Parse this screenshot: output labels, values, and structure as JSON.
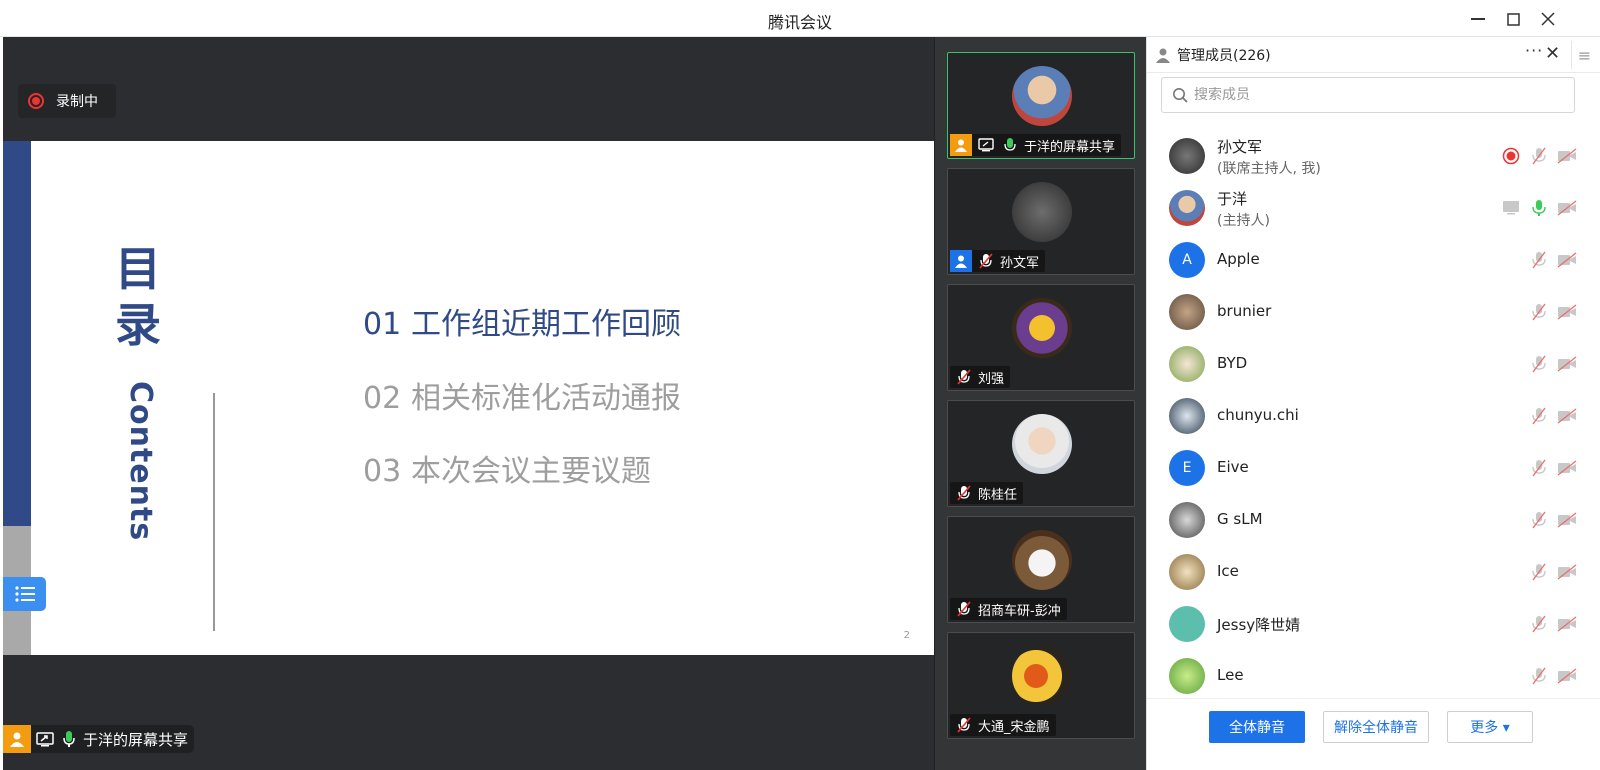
{
  "window": {
    "title": "腾讯会议",
    "minimize_icon": "minimize-icon",
    "maximize_icon": "maximize-icon",
    "close_icon": "close-icon"
  },
  "recording": {
    "label": "录制中",
    "color": "#e33333"
  },
  "slide": {
    "heading": "目录",
    "heading_en": "Contents",
    "items": [
      {
        "num": "01",
        "text": "工作组近期工作回顾"
      },
      {
        "num": "02",
        "text": "相关标准化活动通报"
      },
      {
        "num": "03",
        "text": "本次会议主要议题"
      }
    ],
    "page_number": "2",
    "accent_color": "#2f4a86"
  },
  "share_label": "于洋的屏幕共享",
  "video_tiles": [
    {
      "name": "于洋的屏幕共享",
      "active": true
    },
    {
      "name": "孙文军"
    },
    {
      "name": "刘强"
    },
    {
      "name": "陈桂任"
    },
    {
      "name": "招商车研-彭冲"
    },
    {
      "name": "大通_宋金鹏"
    }
  ],
  "panel": {
    "title": "管理成员(226)",
    "search_placeholder": "搜索成员",
    "members": [
      {
        "name": "孙文军",
        "role": "(联席主持人, 我)"
      },
      {
        "name": "于洋",
        "role": "(主持人)"
      },
      {
        "name": "Apple",
        "initial": "A"
      },
      {
        "name": "brunier"
      },
      {
        "name": "BYD"
      },
      {
        "name": "chunyu.chi"
      },
      {
        "name": "Eive",
        "initial": "E"
      },
      {
        "name": "G sLM"
      },
      {
        "name": "Ice"
      },
      {
        "name": "Jessy降世婧"
      },
      {
        "name": "Lee"
      }
    ],
    "buttons": {
      "mute_all": "全体静音",
      "unmute_all": "解除全体静音",
      "more": "更多 ▾"
    },
    "accent_color": "#1d72e8"
  }
}
